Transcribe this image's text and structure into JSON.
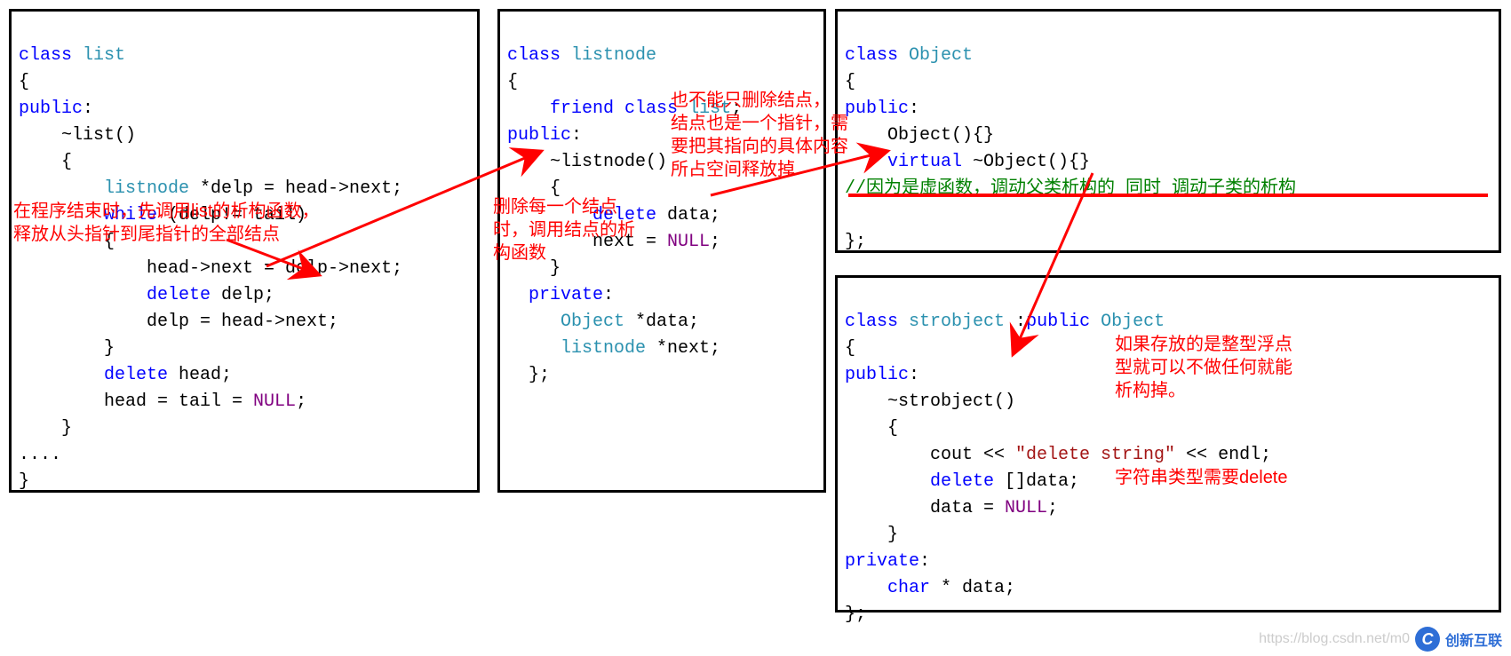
{
  "panel1": {
    "l1a": "class",
    "l1b": " list",
    "l2": "{",
    "l3a": "public",
    "l3b": ":",
    "l4": "    ~list()",
    "l5": "    {",
    "l6a": "        ",
    "l6b": "listnode",
    "l6c": " *delp = head->next;",
    "l7a": "        ",
    "l7b": "while",
    "l7c": " (delp!= tail)",
    "l8": "        {",
    "l9": "            head->next = delp->next;",
    "l10a": "            ",
    "l10b": "delete",
    "l10c": " delp;",
    "l11": "            delp = head->next;",
    "l12": "        }",
    "l13a": "        ",
    "l13b": "delete",
    "l13c": " head;",
    "l14a": "        head = tail = ",
    "l14b": "NULL",
    "l14c": ";",
    "l15": "    }",
    "l16": "....",
    "l17": "}"
  },
  "panel2": {
    "l1a": "class",
    "l1b": " listnode",
    "l2": "{",
    "l3a": "    ",
    "l3b": "friend",
    "l3c": " ",
    "l3d": "class",
    "l3e": " ",
    "l3f": "list",
    "l3g": ";",
    "l4a": "public",
    "l4b": ":",
    "l5": "    ~listnode()",
    "l6": "    {",
    "l7a": "        ",
    "l7b": "delete",
    "l7c": " data;",
    "l8a": "        next = ",
    "l8b": "NULL",
    "l8c": ";",
    "l9": "    }",
    "l10a": "  ",
    "l10b": "private",
    "l10c": ":",
    "l11a": "     ",
    "l11b": "Object",
    "l11c": " *data;",
    "l12a": "     ",
    "l12b": "listnode",
    "l12c": " *next;",
    "l13": "  };"
  },
  "panel3": {
    "l1a": "class",
    "l1b": " Object",
    "l2": "{",
    "l3a": "public",
    "l3b": ":",
    "l4": "    Object(){}",
    "l5a": "    ",
    "l5b": "virtual",
    "l5c": " ~Object(){}",
    "l6": "//因为是虚函数，调动父类析构的 同时 调动子类的析构",
    "l7": "",
    "l8": "};"
  },
  "panel4": {
    "l1a": "class",
    "l1b": " strobject",
    "l1c": " :",
    "l1d": "public",
    "l1e": " ",
    "l1f": "Object",
    "l2": "{",
    "l3a": "public",
    "l3b": ":",
    "l4": "    ~strobject()",
    "l5": "    {",
    "l6a": "        cout << ",
    "l6b": "\"delete string\"",
    "l6c": " << endl;",
    "l7a": "        ",
    "l7b": "delete",
    "l7c": " []data;",
    "l8a": "        data = ",
    "l8b": "NULL",
    "l8c": ";",
    "l9": "    }",
    "l10a": "private",
    "l10b": ":",
    "l11a": "    ",
    "l11b": "char",
    "l11c": " * data;",
    "l12": "};"
  },
  "annots": {
    "a1": "在程序结束时，先调用list的析构函数，\n释放从头指针到尾指针的全部结点",
    "a2": "删除每一个结点\n时，调用结点的析\n构函数",
    "a3": "也不能只删除结点，\n结点也是一个指针，需\n要把其指向的具体内容\n所占空间释放掉",
    "a4": "如果存放的是整型浮点\n型就可以不做任何就能\n析构掉。",
    "a5": "字符串类型需要delete"
  },
  "watermark": {
    "url": "https://blog.csdn.net/m0",
    "brand": "创新互联"
  }
}
